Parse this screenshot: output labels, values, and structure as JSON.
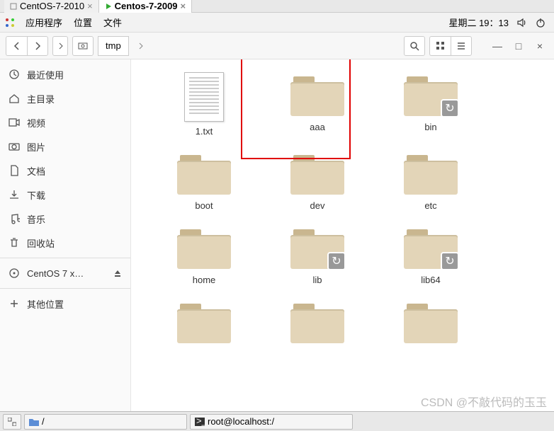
{
  "browser_tabs": [
    {
      "label": "CentOS-7-2010",
      "active": false
    },
    {
      "label": "Centos-7-2009",
      "active": true
    }
  ],
  "menubar": {
    "apps": "应用程序",
    "places": "位置",
    "files": "文件",
    "clock": "星期二 19：13"
  },
  "toolbar": {
    "path_segment": "tmp"
  },
  "sidebar": {
    "items": [
      {
        "label": "最近使用",
        "icon": "clock"
      },
      {
        "label": "主目录",
        "icon": "home"
      },
      {
        "label": "视频",
        "icon": "video"
      },
      {
        "label": "图片",
        "icon": "camera"
      },
      {
        "label": "文档",
        "icon": "doc"
      },
      {
        "label": "下载",
        "icon": "download"
      },
      {
        "label": "音乐",
        "icon": "music"
      },
      {
        "label": "回收站",
        "icon": "trash"
      },
      {
        "label": "CentOS 7 x…",
        "icon": "disc",
        "eject": true
      },
      {
        "label": "其他位置",
        "icon": "plus"
      }
    ]
  },
  "files": [
    {
      "name": "1.txt",
      "type": "doc"
    },
    {
      "name": "aaa",
      "type": "folder",
      "highlighted": true
    },
    {
      "name": "bin",
      "type": "folder",
      "link": true
    },
    {
      "name": "boot",
      "type": "folder"
    },
    {
      "name": "dev",
      "type": "folder"
    },
    {
      "name": "etc",
      "type": "folder"
    },
    {
      "name": "home",
      "type": "folder"
    },
    {
      "name": "lib",
      "type": "folder",
      "link": true
    },
    {
      "name": "lib64",
      "type": "folder",
      "link": true
    },
    {
      "name": "",
      "type": "folder"
    },
    {
      "name": "",
      "type": "folder"
    },
    {
      "name": "",
      "type": "folder"
    }
  ],
  "taskbar": {
    "path": "/",
    "terminal": "root@localhost:/"
  },
  "watermark": "CSDN @不敲代码的玉玉"
}
